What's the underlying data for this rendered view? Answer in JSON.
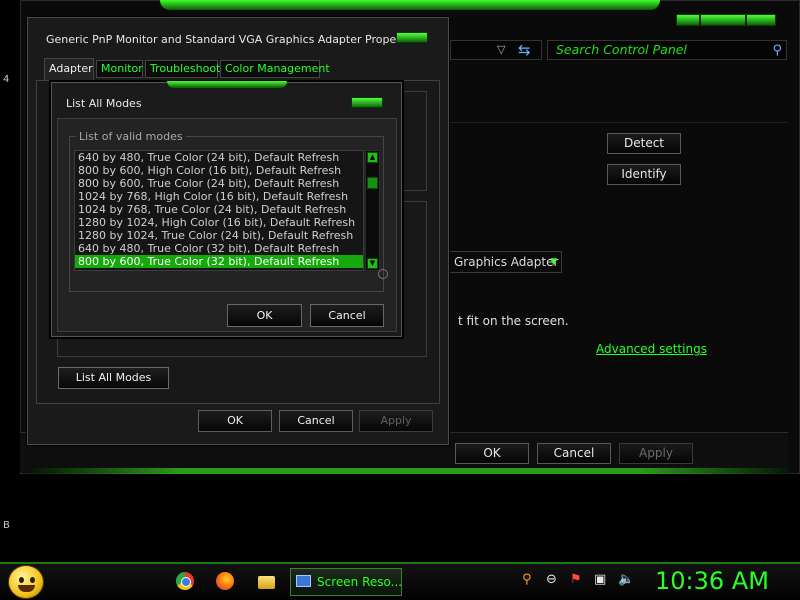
{
  "control_panel": {
    "search_placeholder": "Search Control Panel",
    "detect_label": "Detect",
    "identify_label": "Identify",
    "adapter_dropdown_value": "Graphics Adapter",
    "fit_text": "t fit on the screen.",
    "advanced_link": "Advanced settings",
    "ok_label": "OK",
    "cancel_label": "Cancel",
    "apply_label": "Apply",
    "edge_chars": [
      "4",
      "B"
    ]
  },
  "properties_dialog": {
    "title": "Generic PnP Monitor and Standard VGA Graphics Adapter Properties",
    "tabs": [
      {
        "label": "Adapter",
        "active": true
      },
      {
        "label": "Monitor",
        "active": false
      },
      {
        "label": "Troubleshoot",
        "active": false
      },
      {
        "label": "Color Management",
        "active": false
      }
    ],
    "list_all_modes_button": "List All Modes",
    "ok_label": "OK",
    "cancel_label": "Cancel",
    "apply_label": "Apply"
  },
  "modes_dialog": {
    "title": "List All Modes",
    "group_label": "List of valid modes",
    "modes": [
      "640 by 480, True Color (24 bit), Default Refresh",
      "800 by 600, High Color (16 bit), Default Refresh",
      "800 by 600, True Color (24 bit), Default Refresh",
      "1024 by 768, High Color (16 bit), Default Refresh",
      "1024 by 768, True Color (24 bit), Default Refresh",
      "1280 by 1024, High Color (16 bit), Default Refresh",
      "1280 by 1024, True Color (24 bit), Default Refresh",
      "640 by 480, True Color (32 bit), Default Refresh",
      "800 by 600, True Color (32 bit), Default Refresh"
    ],
    "selected_index": 8,
    "ok_label": "OK",
    "cancel_label": "Cancel"
  },
  "taskbar": {
    "active_task": "Screen Reso...",
    "clock": "10:36 AM",
    "icons": [
      "start-orb-icon",
      "chrome-icon",
      "firefox-icon",
      "folder-icon",
      "search-icon",
      "minus-circle-icon",
      "flag-icon",
      "network-icon",
      "volume-icon"
    ]
  },
  "colors": {
    "accent": "#2aff2a",
    "selection": "#16a90c",
    "background": "#000000"
  }
}
